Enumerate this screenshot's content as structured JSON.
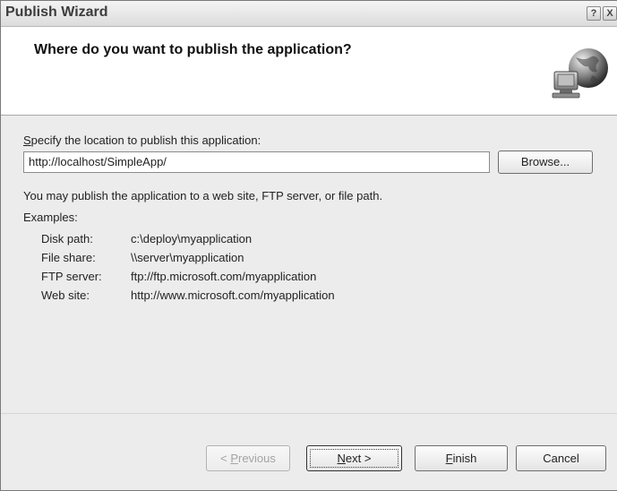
{
  "window": {
    "title": "Publish Wizard",
    "help_button": "?",
    "close_button": "X"
  },
  "header": {
    "heading": "Where do you want to publish the application?",
    "icon": "globe-computer-icon"
  },
  "location": {
    "label_first": "S",
    "label_rest": "pecify the location to publish this application:",
    "value": "http://localhost/SimpleApp/",
    "browse_label": "Browse..."
  },
  "info": {
    "description": "You may publish the application to a web site, FTP server, or file path.",
    "examples_label": "Examples:",
    "examples": [
      {
        "label": "Disk path:",
        "value": "c:\\deploy\\myapplication"
      },
      {
        "label": "File share:",
        "value": "\\\\server\\myapplication"
      },
      {
        "label": "FTP server:",
        "value": "ftp://ftp.microsoft.com/myapplication"
      },
      {
        "label": "Web site:",
        "value": "http://www.microsoft.com/myapplication"
      }
    ]
  },
  "footer": {
    "previous": {
      "prefix": "< ",
      "mnemonic": "P",
      "rest": "revious",
      "enabled": false
    },
    "next": {
      "mnemonic": "N",
      "rest": "ext >",
      "enabled": true
    },
    "finish": {
      "mnemonic": "F",
      "rest": "inish",
      "enabled": true
    },
    "cancel": {
      "label": "Cancel",
      "enabled": true
    }
  }
}
